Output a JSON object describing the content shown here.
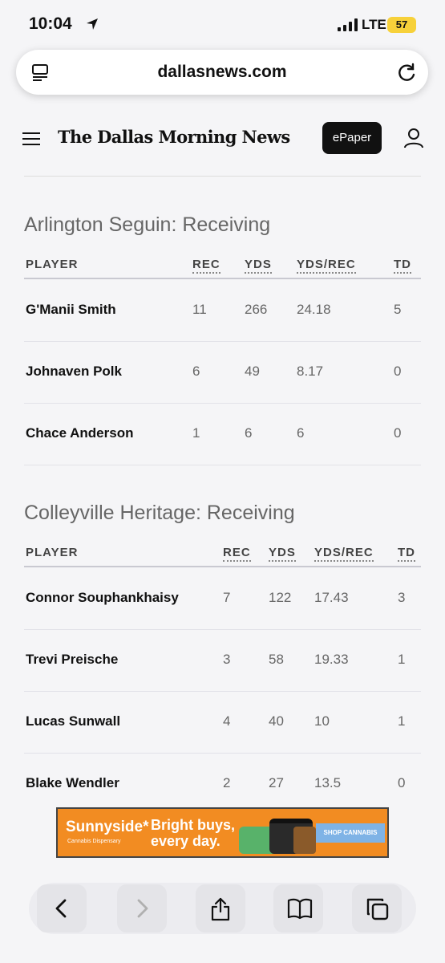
{
  "status_bar": {
    "time": "10:04",
    "network": "LTE",
    "battery": "57"
  },
  "browser": {
    "url": "dallasnews.com"
  },
  "header": {
    "logo": "The Dallas Morning News",
    "epaper_label": "ePaper"
  },
  "sections": [
    {
      "title": "Arlington Seguin: Receiving",
      "columns": [
        "PLAYER",
        "REC",
        "YDS",
        "YDS/REC",
        "TD"
      ],
      "rows": [
        {
          "player": "G'Manii Smith",
          "rec": "11",
          "yds": "266",
          "ydsrec": "24.18",
          "td": "5"
        },
        {
          "player": "Johnaven Polk",
          "rec": "6",
          "yds": "49",
          "ydsrec": "8.17",
          "td": "0"
        },
        {
          "player": "Chace Anderson",
          "rec": "1",
          "yds": "6",
          "ydsrec": "6",
          "td": "0"
        }
      ]
    },
    {
      "title": "Colleyville Heritage: Receiving",
      "columns": [
        "PLAYER",
        "REC",
        "YDS",
        "YDS/REC",
        "TD"
      ],
      "rows": [
        {
          "player": "Connor Souphankhaisy",
          "rec": "7",
          "yds": "122",
          "ydsrec": "17.43",
          "td": "3"
        },
        {
          "player": "Trevi Preische",
          "rec": "3",
          "yds": "58",
          "ydsrec": "19.33",
          "td": "1"
        },
        {
          "player": "Lucas Sunwall",
          "rec": "4",
          "yds": "40",
          "ydsrec": "10",
          "td": "1"
        },
        {
          "player": "Blake Wendler",
          "rec": "2",
          "yds": "27",
          "ydsrec": "13.5",
          "td": "0"
        }
      ]
    }
  ],
  "ad": {
    "brand": "Sunnyside*",
    "brand_sub": "Cannabis Dispensary",
    "tagline": "Bright buys, every day.",
    "cta": "SHOP CANNABIS"
  },
  "toolbar": {
    "icons": [
      "back-icon",
      "forward-icon",
      "share-icon",
      "bookmarks-icon",
      "tabs-icon"
    ]
  }
}
